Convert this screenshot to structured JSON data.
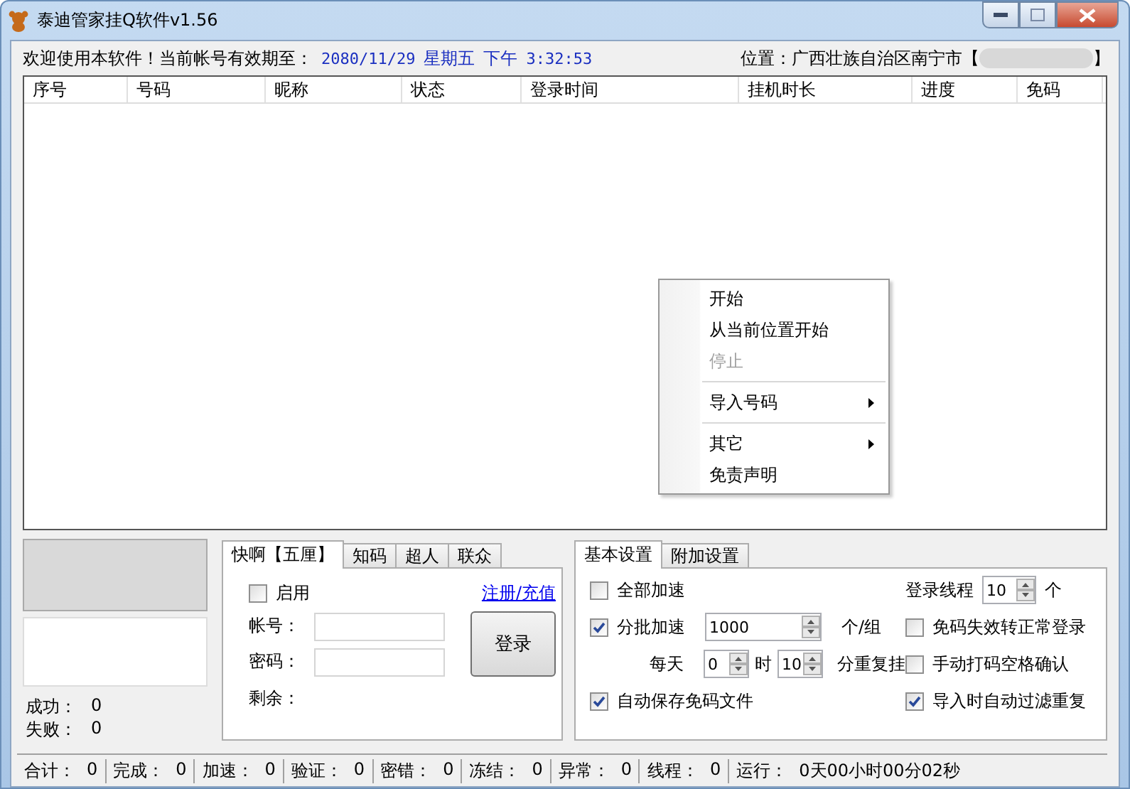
{
  "window": {
    "title": "泰迪管家挂Q软件v1.56"
  },
  "header": {
    "welcome": "欢迎使用本软件！当前帐号有效期至：",
    "expiry": "2080/11/29",
    "weekday": "星期五",
    "ampm": "下午",
    "time": "3:32:53",
    "location": "位置：广西壮族自治区南宁市【",
    "location_end": "】"
  },
  "table": {
    "columns": [
      "序号",
      "号码",
      "昵称",
      "状态",
      "登录时间",
      "挂机时长",
      "进度",
      "免码"
    ]
  },
  "context_menu": {
    "items": [
      {
        "kind": "item",
        "label": "开始",
        "disabled": false,
        "submenu": false
      },
      {
        "kind": "item",
        "label": "从当前位置开始",
        "disabled": false,
        "submenu": false
      },
      {
        "kind": "item",
        "label": "停止",
        "disabled": true,
        "submenu": false
      },
      {
        "kind": "separator"
      },
      {
        "kind": "item",
        "label": "导入号码",
        "disabled": false,
        "submenu": true
      },
      {
        "kind": "separator"
      },
      {
        "kind": "item",
        "label": "其它",
        "disabled": false,
        "submenu": true
      },
      {
        "kind": "item",
        "label": "免责声明",
        "disabled": false,
        "submenu": false
      }
    ]
  },
  "stats": [
    {
      "label": "成功：",
      "value": "0"
    },
    {
      "label": "失败：",
      "value": "0"
    }
  ],
  "platform_tabs": [
    {
      "label": "快啊【五厘】",
      "selected": true
    },
    {
      "label": "知码",
      "selected": false
    },
    {
      "label": "超人",
      "selected": false
    },
    {
      "label": "联众",
      "selected": false
    }
  ],
  "platform_form": {
    "enable": {
      "label": "启用",
      "checked": false
    },
    "register_link": "注册/充值",
    "account_label": "帐号：",
    "password_label": "密码：",
    "remaining_label": "剩余：",
    "login_button": "登录"
  },
  "settings_tabs": [
    {
      "label": "基本设置",
      "selected": true
    },
    {
      "label": "附加设置",
      "selected": false
    }
  ],
  "settings": {
    "all_speedup": {
      "label": "全部加速",
      "checked": false
    },
    "threads": {
      "label": "登录线程",
      "value": "10",
      "unit": "个"
    },
    "batch": {
      "label": "分批加速",
      "checked": true
    },
    "batch_size": {
      "value": "1000",
      "unit": "个/组"
    },
    "fallback": {
      "label": "免码失效转正常登录",
      "checked": false
    },
    "daily_label": "每天",
    "hour": {
      "value": "0",
      "unit": "时"
    },
    "minute": {
      "value": "10",
      "unit": "分重复挂"
    },
    "manual": {
      "label": "手动打码空格确认",
      "checked": false
    },
    "autosave": {
      "label": "自动保存免码文件",
      "checked": true
    },
    "dedupe": {
      "label": "导入时自动过滤重复",
      "checked": true
    }
  },
  "status_bar": [
    {
      "label": "合计：",
      "value": "0"
    },
    {
      "label": "完成：",
      "value": "0"
    },
    {
      "label": "加速：",
      "value": "0"
    },
    {
      "label": "验证：",
      "value": "0"
    },
    {
      "label": "密错：",
      "value": "0"
    },
    {
      "label": "冻结：",
      "value": "0"
    },
    {
      "label": "异常：",
      "value": "0"
    },
    {
      "label": "线程：",
      "value": "0"
    },
    {
      "label": "运行：",
      "value": "0天00小时00分02秒"
    }
  ]
}
